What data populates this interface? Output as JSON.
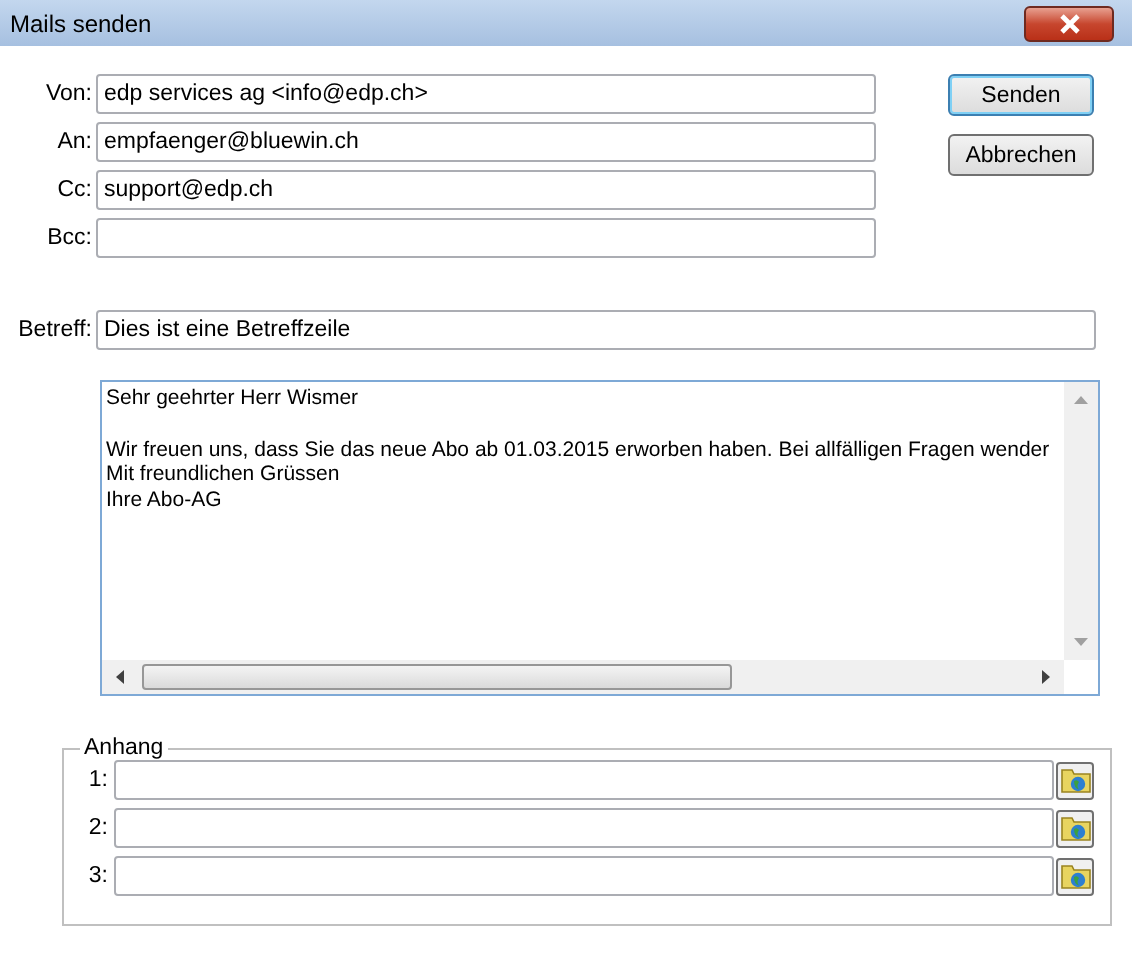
{
  "window": {
    "title": "Mails senden"
  },
  "fields": [
    {
      "label": "Von:",
      "value": "edp services ag <info@edp.ch>"
    },
    {
      "label": "An:",
      "value": "empfaenger@bluewin.ch"
    },
    {
      "label": "Cc:",
      "value": "support@edp.ch"
    },
    {
      "label": "Bcc:"
    }
  ],
  "buttons": [
    {
      "label": "Senden",
      "default": true
    },
    {
      "label": "Abbrechen",
      "default": false
    }
  ],
  "subject": {
    "label": "Betreff:",
    "value": "Dies ist eine Betreffzeile"
  },
  "body": {
    "text": "Sehr geehrter Herr Wismer\n\nWir freuen uns, dass Sie das neue Abo ab 01.03.2015 erworben haben. Bei allfälligen Fragen wender\nMit freundlichen Grüssen\nIhre Abo-AG"
  },
  "attachments": {
    "title": "Anhang",
    "rows": [
      {
        "label": "1:"
      },
      {
        "label": "2:"
      },
      {
        "label": "3:"
      }
    ]
  }
}
